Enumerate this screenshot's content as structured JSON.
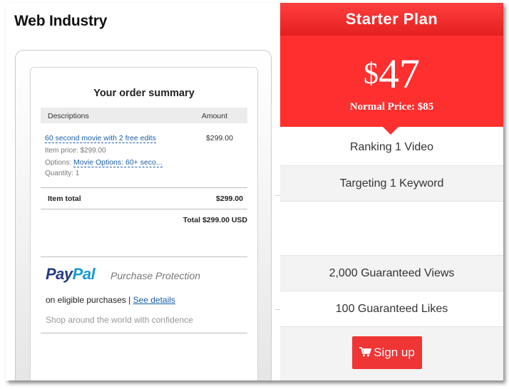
{
  "site": {
    "title": "Web Industry"
  },
  "order": {
    "title": "Your order summary",
    "col_descriptions": "Descriptions",
    "col_amount": "Amount",
    "item_name": "60 second movie with 2 free edits",
    "item_amount": "$299.00",
    "item_price": "Item price: $299.00",
    "options_label": "Options:",
    "options_value": "Movie Options: 60+ seco...",
    "quantity": "Quantity: 1",
    "item_total_label": "Item total",
    "item_total_value": "$299.00",
    "grand_total": "Total $299.00 USD"
  },
  "paypal": {
    "logo_pay": "Pay",
    "logo_pal": "Pal",
    "protection": "Purchase Protection",
    "eligible": "on eligible purchases |",
    "see_details": "See details",
    "shop": "Shop around the world with confidence"
  },
  "plan": {
    "name": "Starter Plan",
    "currency": "$",
    "price": "47",
    "normal_price": "Normal Price: $85",
    "features": [
      "Ranking 1 Video",
      "Targeting 1 Keyword",
      "",
      "2,000 Guaranteed Views",
      "100 Guaranteed Likes"
    ],
    "signup_label": "Sign up",
    "accent_color": "#fd2f2f"
  }
}
